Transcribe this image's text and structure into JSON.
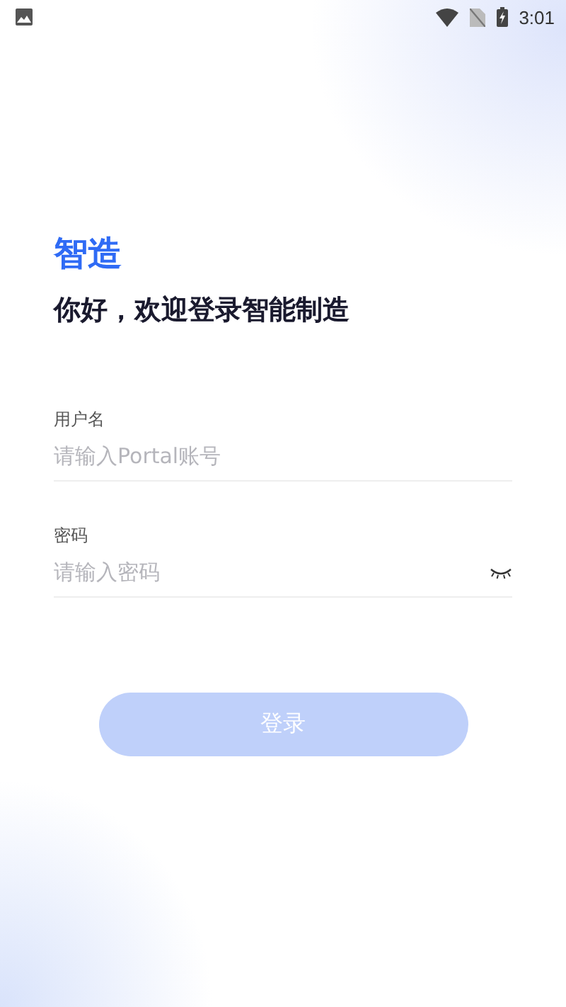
{
  "status_bar": {
    "time": "3:01"
  },
  "brand": "智造",
  "greeting": "你好，欢迎登录智能制造",
  "fields": [
    {
      "kind": "text",
      "label": "用户名",
      "placeholder": "请输入Portal账号"
    },
    {
      "kind": "password",
      "label": "密码",
      "placeholder": "请输入密码"
    }
  ],
  "login_button": {
    "label": "登录",
    "disabled": true
  }
}
